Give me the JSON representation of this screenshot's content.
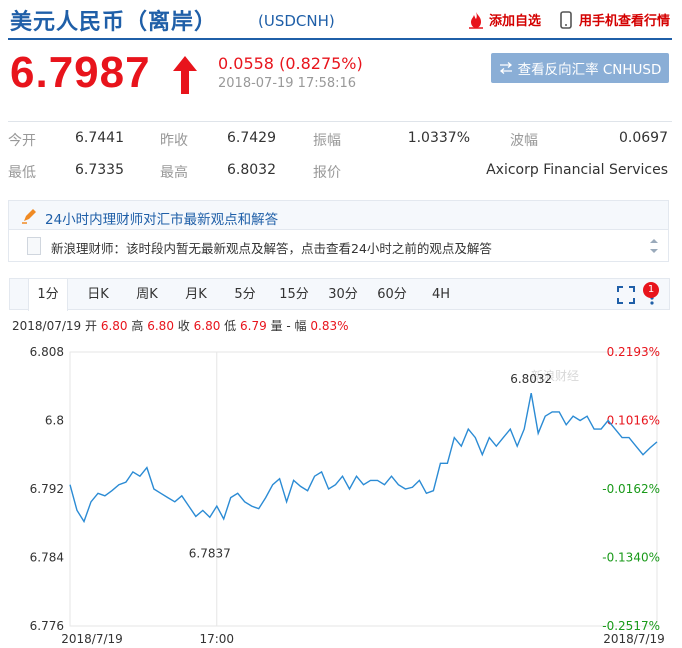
{
  "header": {
    "title": "美元人民币（离岸）",
    "code": "(USDCNH)",
    "add_watchlist": "添加自选",
    "mobile_view": "用手机查看行情"
  },
  "quote": {
    "price": "6.7987",
    "change": "0.0558 (0.8275%)",
    "datetime": "2018-07-19  17:58:16",
    "reverse_button": "查看反向汇率 CNHUSD"
  },
  "stats": {
    "row1": [
      {
        "label": "今开",
        "value": "6.7441"
      },
      {
        "label": "昨收",
        "value": "6.7429"
      },
      {
        "label": "振幅",
        "value": "1.0337%"
      },
      {
        "label": "波幅",
        "value": "0.0697"
      }
    ],
    "row2": [
      {
        "label": "最低",
        "value": "6.7335"
      },
      {
        "label": "最高",
        "value": "6.8032"
      },
      {
        "label": "报价",
        "value": "Axicorp Financial Services"
      }
    ]
  },
  "news": {
    "heading": "24小时内理财师对汇市最新观点和解答",
    "body": "新浪理财师：该时段内暂无最新观点及解答，点击查看24小时之前的观点及解答"
  },
  "tabs": [
    "1分",
    "日K",
    "周K",
    "月K",
    "5分",
    "15分",
    "30分",
    "60分",
    "4H"
  ],
  "badge": "1",
  "ohlc": {
    "date": "2018/07/19",
    "open_label": "开",
    "open": "6.80",
    "high_label": "高",
    "high": "6.80",
    "close_label": "收",
    "close": "6.80",
    "low_label": "低",
    "low": "6.79",
    "vol_label": "量 -",
    "amp_label": "幅",
    "amp": "0.83%"
  },
  "colors": {
    "up": "#e8141c",
    "down": "#1a9a1a",
    "line": "#2b8bd4",
    "brand": "#1f5fa8"
  },
  "chart_data": {
    "type": "line",
    "watermark": "新浪财经",
    "ylim": [
      6.776,
      6.808
    ],
    "yticks": [
      "6.808",
      "6.8",
      "6.792",
      "6.784",
      "6.776"
    ],
    "pct_ticks": [
      {
        "value": 6.808,
        "label": "0.2193%",
        "dir": "up"
      },
      {
        "value": 6.8,
        "label": "0.1016%",
        "dir": "up"
      },
      {
        "value": 6.792,
        "label": "-0.0162%",
        "dir": "down"
      },
      {
        "value": 6.784,
        "label": "-0.1340%",
        "dir": "down"
      },
      {
        "value": 6.776,
        "label": "-0.2517%",
        "dir": "down"
      }
    ],
    "xticks": [
      {
        "index": 0,
        "label": "2018/7/19"
      },
      {
        "index": 21,
        "label": "17:00"
      },
      {
        "index": 84,
        "label": "2018/7/19"
      }
    ],
    "annotations": [
      {
        "index": 66,
        "label": "6.8032"
      },
      {
        "index": 20,
        "label": "6.7837"
      }
    ],
    "grid": false,
    "values": [
      6.7925,
      6.7895,
      6.7882,
      6.7905,
      6.7915,
      6.7912,
      6.7918,
      6.7925,
      6.7928,
      6.794,
      6.7935,
      6.7945,
      6.792,
      6.7915,
      6.791,
      6.7905,
      6.7912,
      6.79,
      6.7888,
      6.7895,
      6.7887,
      6.79,
      6.7885,
      6.791,
      6.7915,
      6.7905,
      6.79,
      6.7897,
      6.791,
      6.7925,
      6.7932,
      6.7905,
      6.793,
      6.7923,
      6.7918,
      6.7935,
      6.794,
      6.792,
      6.7925,
      6.7935,
      6.792,
      6.7935,
      6.7925,
      6.793,
      6.793,
      6.7925,
      6.7935,
      6.7925,
      6.792,
      6.7922,
      6.793,
      6.7915,
      6.7918,
      6.795,
      6.795,
      6.798,
      6.797,
      6.799,
      6.798,
      6.796,
      6.798,
      6.797,
      6.798,
      6.799,
      6.797,
      6.799,
      6.8032,
      6.7985,
      6.8005,
      6.801,
      6.801,
      6.7995,
      6.8005,
      6.8,
      6.8005,
      6.799,
      6.799,
      6.8,
      6.799,
      6.798,
      6.798,
      6.797,
      6.796,
      6.7968,
      6.7975
    ]
  }
}
